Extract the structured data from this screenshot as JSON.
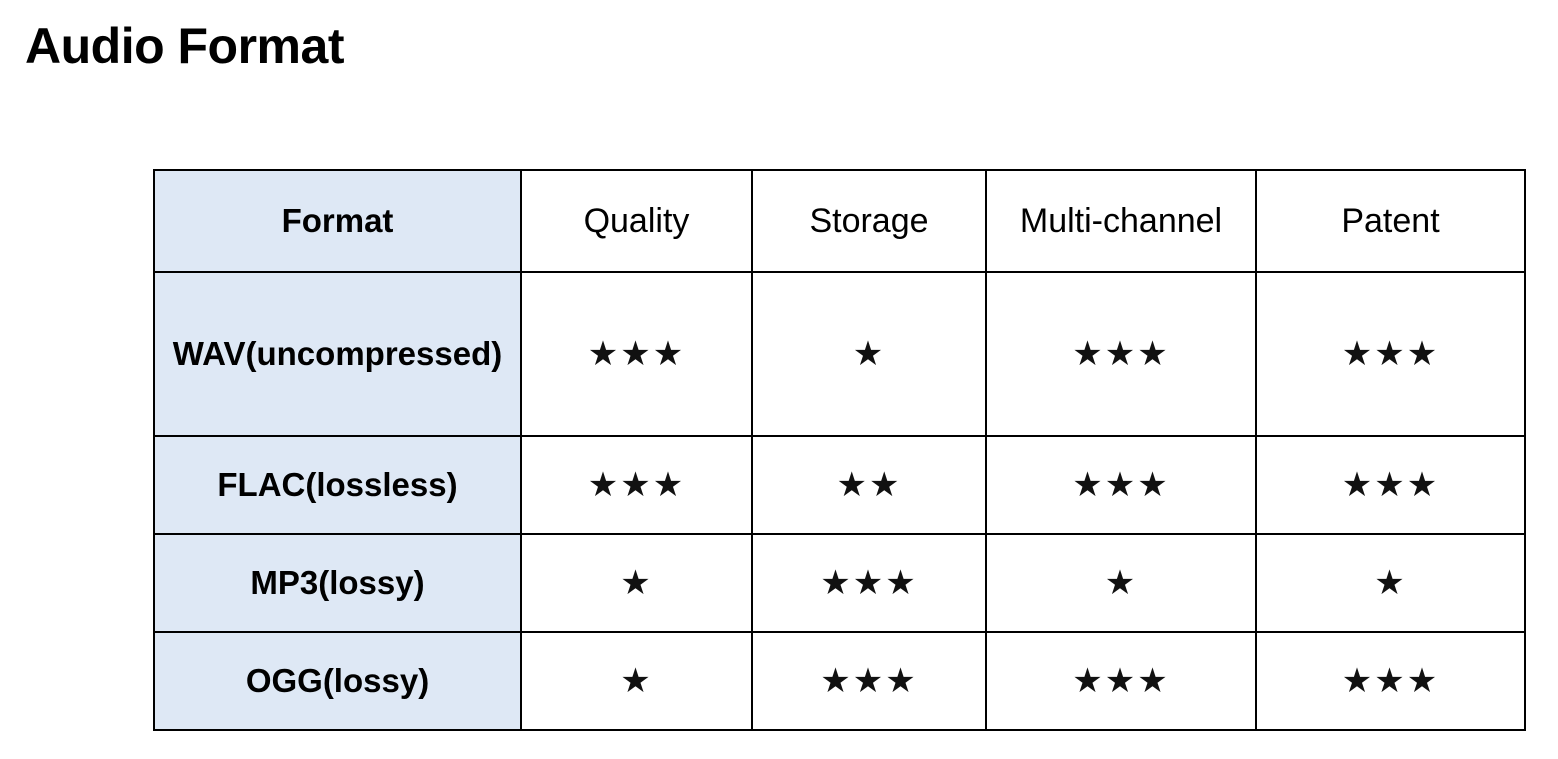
{
  "title": "Audio Format",
  "table": {
    "headers": [
      "Format",
      "Quality",
      "Storage",
      "Multi-channel",
      "Patent"
    ],
    "rows": [
      {
        "format": "WAV(uncompressed)",
        "quality": "★★★",
        "storage": "★",
        "multichannel": "★★★",
        "patent": "★★★"
      },
      {
        "format": "FLAC(lossless)",
        "quality": "★★★",
        "storage": "★★",
        "multichannel": "★★★",
        "patent": "★★★"
      },
      {
        "format": "MP3(lossy)",
        "quality": "★",
        "storage": "★★★",
        "multichannel": "★",
        "patent": "★"
      },
      {
        "format": "OGG(lossy)",
        "quality": "★",
        "storage": "★★★",
        "multichannel": "★★★",
        "patent": "★★★"
      }
    ]
  },
  "colors": {
    "header_column_fill": "#dee8f5",
    "border": "#000000"
  }
}
